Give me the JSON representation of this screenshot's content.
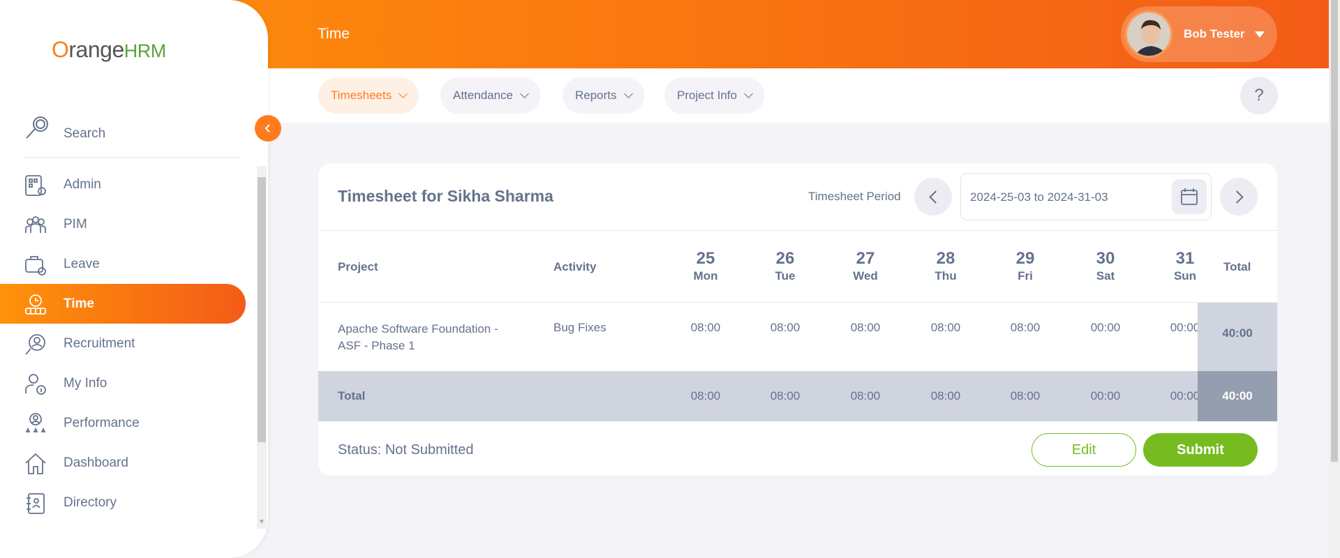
{
  "header": {
    "module_title": "Time",
    "user_name": "Bob Tester"
  },
  "brand": {
    "logo_orange": "O",
    "logo_text": "range",
    "logo_hrm": "HRM"
  },
  "sidebar": {
    "search_label": "Search",
    "items": [
      {
        "label": "Admin",
        "icon": "admin-icon"
      },
      {
        "label": "PIM",
        "icon": "pim-icon"
      },
      {
        "label": "Leave",
        "icon": "leave-icon"
      },
      {
        "label": "Time",
        "icon": "time-icon",
        "active": true
      },
      {
        "label": "Recruitment",
        "icon": "recruitment-icon"
      },
      {
        "label": "My Info",
        "icon": "my-info-icon"
      },
      {
        "label": "Performance",
        "icon": "performance-icon"
      },
      {
        "label": "Dashboard",
        "icon": "dashboard-icon"
      },
      {
        "label": "Directory",
        "icon": "directory-icon"
      }
    ]
  },
  "subnav": {
    "items": [
      {
        "label": "Timesheets",
        "active": true
      },
      {
        "label": "Attendance"
      },
      {
        "label": "Reports"
      },
      {
        "label": "Project Info"
      }
    ],
    "help_label": "?"
  },
  "timesheet": {
    "title": "Timesheet for Sikha Sharma",
    "period_label": "Timesheet Period",
    "period_value": "2024-25-03 to 2024-31-03",
    "columns": {
      "project": "Project",
      "activity": "Activity",
      "total": "Total"
    },
    "days": [
      {
        "num": "25",
        "name": "Mon"
      },
      {
        "num": "26",
        "name": "Tue"
      },
      {
        "num": "27",
        "name": "Wed"
      },
      {
        "num": "28",
        "name": "Thu"
      },
      {
        "num": "29",
        "name": "Fri"
      },
      {
        "num": "30",
        "name": "Sat"
      },
      {
        "num": "31",
        "name": "Sun"
      }
    ],
    "rows": [
      {
        "project_line1": "Apache Software Foundation -",
        "project_line2": "ASF - Phase 1",
        "activity": "Bug Fixes",
        "hours": [
          "08:00",
          "08:00",
          "08:00",
          "08:00",
          "08:00",
          "00:00",
          "00:00"
        ],
        "total": "40:00"
      }
    ],
    "totals": {
      "label": "Total",
      "hours": [
        "08:00",
        "08:00",
        "08:00",
        "08:00",
        "08:00",
        "00:00",
        "00:00"
      ],
      "grand_total": "40:00"
    },
    "status": "Status: Not Submitted",
    "edit_label": "Edit",
    "submit_label": "Submit"
  },
  "colors": {
    "accent": "#ff7b1d",
    "success": "#76bc21",
    "text": "#64728c"
  }
}
